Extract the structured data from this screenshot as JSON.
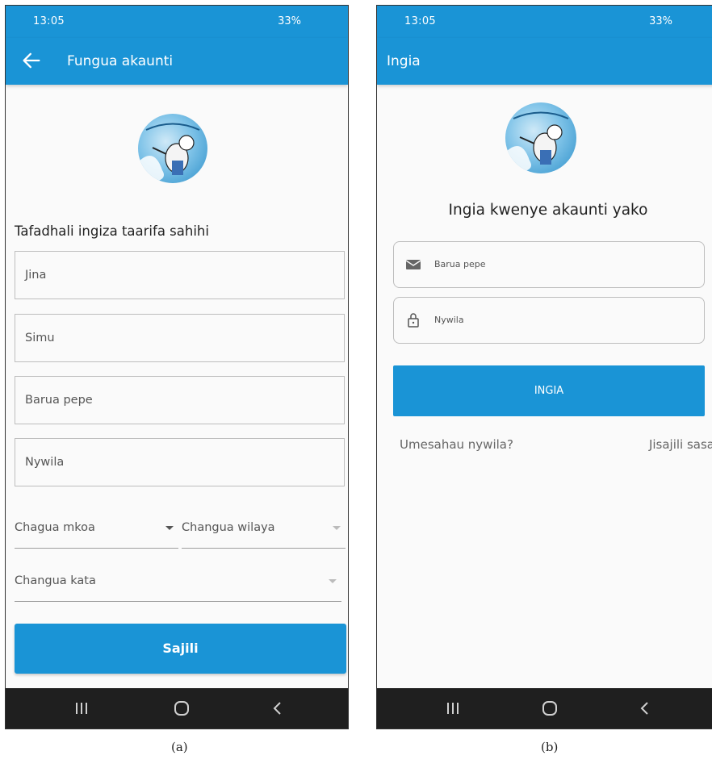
{
  "status_bar": {
    "time": "13:05",
    "battery": "33%"
  },
  "screen_a": {
    "title": "Fungua akaunti",
    "subtitle": "Tafadhali ingiza taarifa sahihi",
    "fields": [
      {
        "placeholder": "Jina"
      },
      {
        "placeholder": "Simu"
      },
      {
        "placeholder": "Barua pepe"
      },
      {
        "placeholder": "Nywila"
      }
    ],
    "dropdowns": [
      {
        "label": "Chagua mkoa"
      },
      {
        "label": "Changua wilaya"
      },
      {
        "label": "Changua kata"
      }
    ],
    "submit_label": "Sajili"
  },
  "screen_b": {
    "title": "Ingia",
    "subtitle": "Ingia kwenye akaunti yako",
    "email_placeholder": "Barua pepe",
    "password_placeholder": "Nywila",
    "login_label": "INGIA",
    "forgot_label": "Umesahau nywila?",
    "register_label": "Jisajili sasa"
  },
  "captions": {
    "a": "(a)",
    "b": "(b)"
  },
  "colors": {
    "accent": "#1a94d6",
    "nav_bar": "#1f1f1f"
  },
  "icons": [
    "back-arrow-icon",
    "mail-icon",
    "lock-icon",
    "recents-icon",
    "home-icon",
    "nav-back-icon"
  ]
}
